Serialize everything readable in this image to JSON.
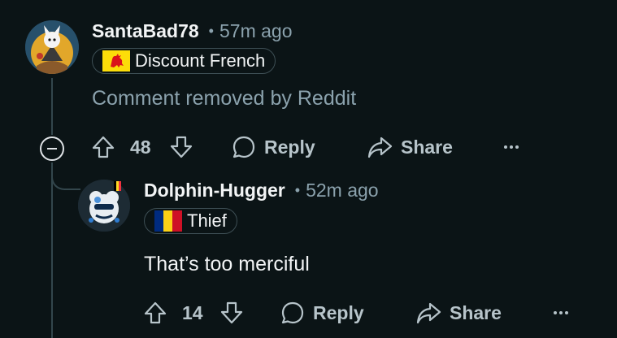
{
  "comments": [
    {
      "username": "SantaBad78",
      "separator": "•",
      "time": "57m ago",
      "flair": "Discount French",
      "body": "Comment removed by Reddit",
      "votes": "48",
      "reply_label": "Reply",
      "share_label": "Share"
    },
    {
      "username": "Dolphin-Hugger",
      "separator": "•",
      "time": "52m ago",
      "flair": "Thief",
      "body": "That’s too merciful",
      "votes": "14",
      "reply_label": "Reply",
      "share_label": "Share"
    }
  ],
  "icons": {
    "upvote": "upvote-arrow-icon",
    "downvote": "downvote-arrow-icon",
    "reply": "speech-bubble-icon",
    "share": "share-arrow-icon",
    "more": "more-dots-icon",
    "collapse": "collapse-minus-icon"
  },
  "colors": {
    "background": "#0b1416",
    "text": "#f2f4f5",
    "muted": "#8ba2ad",
    "action": "#b7c4ca",
    "thread_line": "#33464c",
    "flair_yellow": "#fcdd09",
    "flair_red": "#da121a",
    "romania_blue": "#002b7f",
    "romania_yellow": "#fcd116",
    "romania_red": "#ce1126"
  }
}
